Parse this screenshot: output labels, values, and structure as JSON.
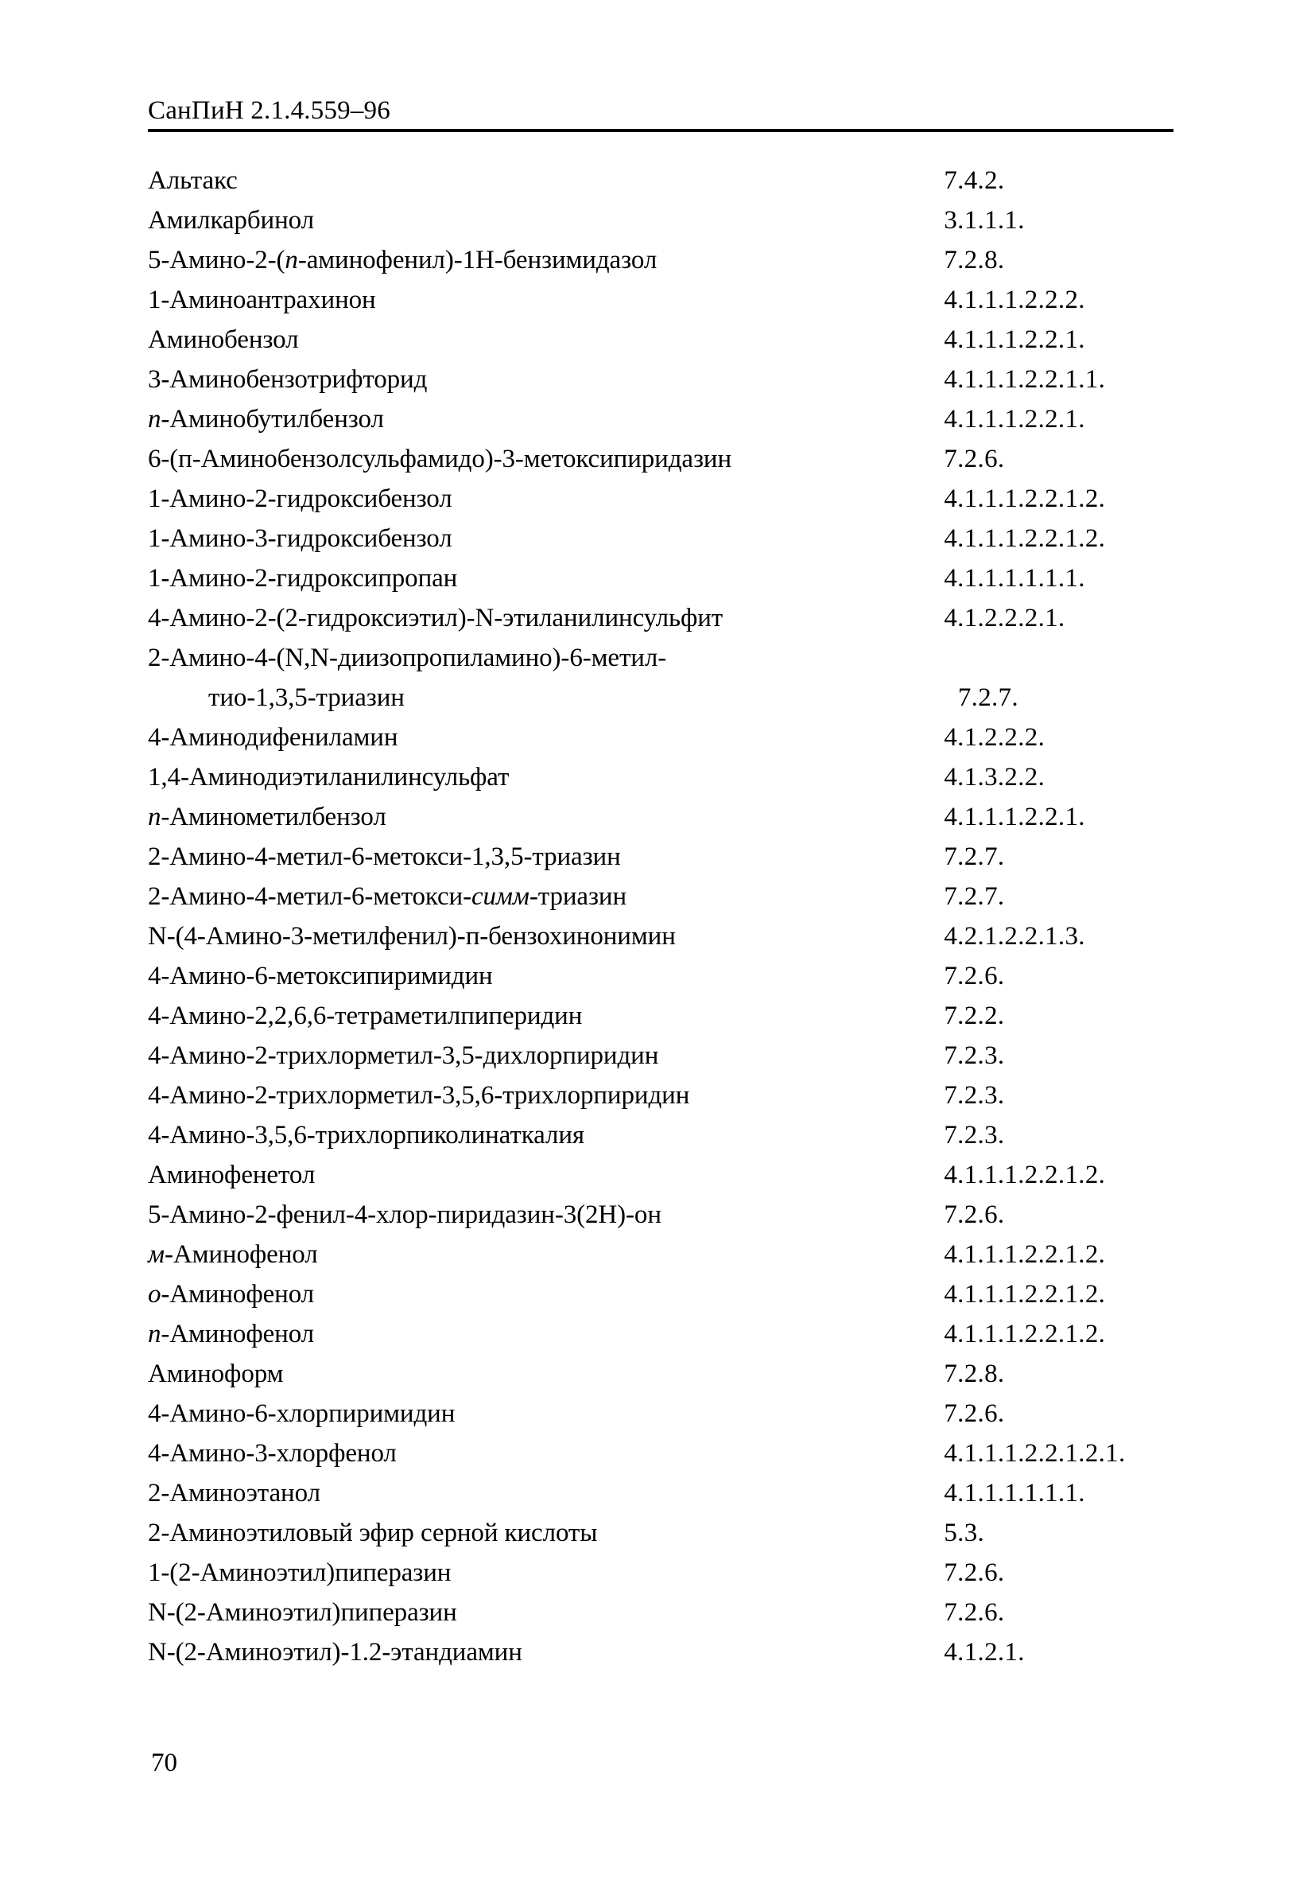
{
  "header": {
    "document_code": "СанПиН 2.1.4.559–96"
  },
  "footer": {
    "page_number": "70"
  },
  "index": {
    "rows": [
      {
        "name_pre": "",
        "name_italic": "",
        "name_post": "Альтакс",
        "code": "7.4.2.",
        "continuation": false
      },
      {
        "name_pre": "",
        "name_italic": "",
        "name_post": "Амилкарбинол",
        "code": "3.1.1.1.",
        "continuation": false
      },
      {
        "name_pre": "5-Амино-2-(",
        "name_italic": "n",
        "name_post": "-аминофенил)-1Н-бензимидазол",
        "code": "7.2.8.",
        "continuation": false
      },
      {
        "name_pre": "",
        "name_italic": "",
        "name_post": "1-Аминоантрахинон",
        "code": "4.1.1.1.2.2.2.",
        "continuation": false
      },
      {
        "name_pre": "",
        "name_italic": "",
        "name_post": "Аминобензол",
        "code": "4.1.1.1.2.2.1.",
        "continuation": false
      },
      {
        "name_pre": "",
        "name_italic": "",
        "name_post": "3-Аминобензотрифторид",
        "code": "4.1.1.1.2.2.1.1.",
        "continuation": false
      },
      {
        "name_pre": "",
        "name_italic": "n",
        "name_post": "-Аминобутилбензол",
        "code": "4.1.1.1.2.2.1.",
        "continuation": false
      },
      {
        "name_pre": "",
        "name_italic": "",
        "name_post": "6-(п-Аминобензолсульфамидо)-3-метоксипиридазин",
        "code": "7.2.6.",
        "continuation": false
      },
      {
        "name_pre": "",
        "name_italic": "",
        "name_post": "1-Амино-2-гидроксибензол",
        "code": "4.1.1.1.2.2.1.2.",
        "continuation": false
      },
      {
        "name_pre": "",
        "name_italic": "",
        "name_post": "1-Амино-3-гидроксибензол",
        "code": "4.1.1.1.2.2.1.2.",
        "continuation": false
      },
      {
        "name_pre": "",
        "name_italic": "",
        "name_post": "1-Амино-2-гидроксипропан",
        "code": "4.1.1.1.1.1.1.",
        "continuation": false
      },
      {
        "name_pre": "",
        "name_italic": "",
        "name_post": "4-Амино-2-(2-гидроксиэтил)-N-этиланилинсульфит",
        "code": "4.1.2.2.2.1.",
        "continuation": false
      },
      {
        "name_pre": "",
        "name_italic": "",
        "name_post": "2-Амино-4-(N,N-диизопропиламино)-6-метил-",
        "code": "",
        "continuation": false
      },
      {
        "name_pre": "",
        "name_italic": "",
        "name_post": "тио-1,3,5-триазин",
        "code": "7.2.7.",
        "continuation": true
      },
      {
        "name_pre": "",
        "name_italic": "",
        "name_post": "4-Аминодифениламин",
        "code": "4.1.2.2.2.",
        "continuation": false
      },
      {
        "name_pre": "",
        "name_italic": "",
        "name_post": "1,4-Аминодиэтиланилинсульфат",
        "code": "4.1.3.2.2.",
        "continuation": false
      },
      {
        "name_pre": "",
        "name_italic": "n",
        "name_post": "-Аминометилбензол",
        "code": "4.1.1.1.2.2.1.",
        "continuation": false
      },
      {
        "name_pre": "",
        "name_italic": "",
        "name_post": "2-Амино-4-метил-6-метокси-1,3,5-триазин",
        "code": "7.2.7.",
        "continuation": false
      },
      {
        "name_pre": "2-Амино-4-метил-6-метокси-",
        "name_italic": "симм",
        "name_post": "-триазин",
        "code": "7.2.7.",
        "continuation": false
      },
      {
        "name_pre": "",
        "name_italic": "",
        "name_post": "N-(4-Амино-3-метилфенил)-п-бензохинонимин",
        "code": "4.2.1.2.2.1.3.",
        "continuation": false
      },
      {
        "name_pre": "",
        "name_italic": "",
        "name_post": "4-Амино-6-метоксипиримидин",
        "code": "7.2.6.",
        "continuation": false
      },
      {
        "name_pre": "",
        "name_italic": "",
        "name_post": "4-Амино-2,2,6,6-тетраметилпиперидин",
        "code": "7.2.2.",
        "continuation": false
      },
      {
        "name_pre": "",
        "name_italic": "",
        "name_post": "4-Амино-2-трихлорметил-3,5-дихлорпиридин",
        "code": "7.2.3.",
        "continuation": false
      },
      {
        "name_pre": "",
        "name_italic": "",
        "name_post": "4-Амино-2-трихлорметил-3,5,6-трихлорпиридин",
        "code": "7.2.3.",
        "continuation": false
      },
      {
        "name_pre": "",
        "name_italic": "",
        "name_post": "4-Амино-3,5,6-трихлорпиколинаткалия",
        "code": "7.2.3.",
        "continuation": false
      },
      {
        "name_pre": "",
        "name_italic": "",
        "name_post": "Аминофенетол",
        "code": "4.1.1.1.2.2.1.2.",
        "continuation": false
      },
      {
        "name_pre": "",
        "name_italic": "",
        "name_post": "5-Амино-2-фенил-4-хлор-пиридазин-3(2Н)-он",
        "code": "7.2.6.",
        "continuation": false
      },
      {
        "name_pre": "",
        "name_italic": "м",
        "name_post": "-Аминофенол",
        "code": "4.1.1.1.2.2.1.2.",
        "continuation": false
      },
      {
        "name_pre": "",
        "name_italic": "о",
        "name_post": "-Аминофенол",
        "code": "4.1.1.1.2.2.1.2.",
        "continuation": false
      },
      {
        "name_pre": "",
        "name_italic": "n",
        "name_post": "-Аминофенол",
        "code": "4.1.1.1.2.2.1.2.",
        "continuation": false
      },
      {
        "name_pre": "",
        "name_italic": "",
        "name_post": "Аминоформ",
        "code": "7.2.8.",
        "continuation": false
      },
      {
        "name_pre": "",
        "name_italic": "",
        "name_post": "4-Амино-6-хлорпиримидин",
        "code": "7.2.6.",
        "continuation": false
      },
      {
        "name_pre": "",
        "name_italic": "",
        "name_post": "4-Амино-3-хлорфенол",
        "code": "4.1.1.1.2.2.1.2.1.",
        "continuation": false
      },
      {
        "name_pre": "",
        "name_italic": "",
        "name_post": "2-Аминоэтанол",
        "code": "4.1.1.1.1.1.1.",
        "continuation": false
      },
      {
        "name_pre": "",
        "name_italic": "",
        "name_post": "2-Аминоэтиловый эфир серной кислоты",
        "code": "5.3.",
        "continuation": false
      },
      {
        "name_pre": "",
        "name_italic": "",
        "name_post": "1-(2-Аминоэтил)пиперазин",
        "code": "7.2.6.",
        "continuation": false
      },
      {
        "name_pre": "",
        "name_italic": "",
        "name_post": "N-(2-Аминоэтил)пиперазин",
        "code": "7.2.6.",
        "continuation": false
      },
      {
        "name_pre": "",
        "name_italic": "",
        "name_post": "N-(2-Аминоэтил)-1.2-этандиамин",
        "code": "4.1.2.1.",
        "continuation": false
      }
    ]
  }
}
